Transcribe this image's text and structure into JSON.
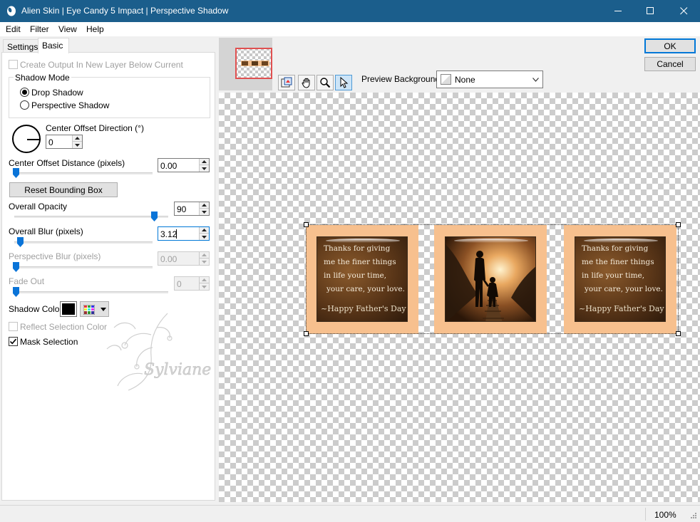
{
  "window": {
    "title": "Alien Skin | Eye Candy 5 Impact | Perspective Shadow"
  },
  "menu": [
    "Edit",
    "Filter",
    "View",
    "Help"
  ],
  "tabs": {
    "settings": "Settings",
    "basic": "Basic"
  },
  "panel": {
    "create_output": "Create Output In New Layer Below Current",
    "shadow_mode_label": "Shadow Mode",
    "drop_shadow": "Drop Shadow",
    "perspective_shadow": "Perspective Shadow",
    "center_offset_direction": "Center Offset Direction (°)",
    "center_offset_direction_value": "0",
    "center_offset_distance": "Center Offset Distance (pixels)",
    "center_offset_distance_value": "0.00",
    "reset_bounding_box": "Reset Bounding Box",
    "overall_opacity": "Overall Opacity",
    "overall_opacity_value": "90",
    "overall_blur": "Overall Blur (pixels)",
    "overall_blur_value": "3.12",
    "perspective_blur": "Perspective Blur (pixels)",
    "perspective_blur_value": "0.00",
    "fade_out": "Fade Out",
    "fade_out_value": "0",
    "shadow_color": "Shadow Color",
    "shadow_color_hex": "#000000",
    "reflect_selection_color": "Reflect Selection Color",
    "mask_selection": "Mask Selection",
    "watermark_text": "Sylviane"
  },
  "slider_levels": {
    "center_offset_distance": 0.0,
    "overall_opacity": 0.9,
    "overall_blur": 0.03,
    "perspective_blur": 0.0,
    "fade_out": 0.0
  },
  "buttons": {
    "ok": "OK",
    "cancel": "Cancel"
  },
  "preview": {
    "background_label": "Preview Background:",
    "background_value": "None",
    "card_lines": [
      "Thanks for giving",
      "me the finer things",
      "in life your time,",
      "your care, your love."
    ],
    "card_signature": "~Happy Father's Day"
  },
  "status": {
    "zoom": "100%"
  }
}
